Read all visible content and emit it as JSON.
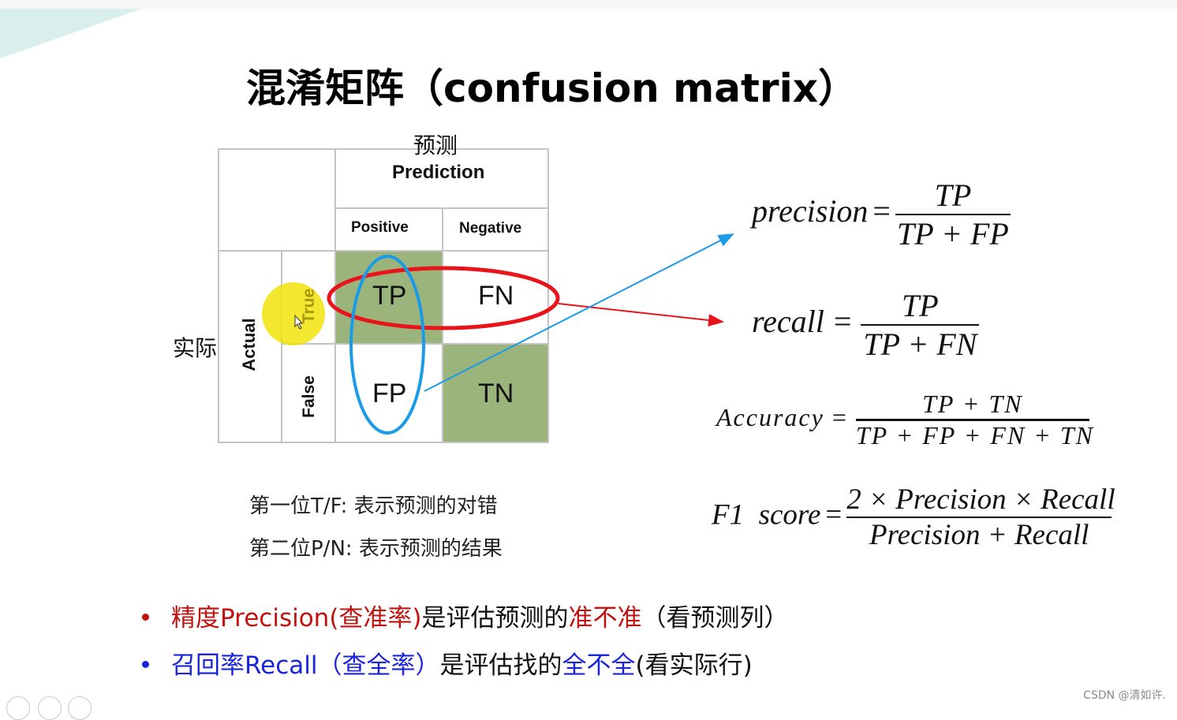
{
  "slide": {
    "title": "混淆矩阵（confusion matrix）",
    "colors": {
      "cell_green": "#9bb47c",
      "red_accent": "#c0120f",
      "blue_accent": "#1a24d8",
      "ellipse_red": "#e8141a",
      "ellipse_blue": "#1a9be8",
      "deco_teal": "#d9efec"
    }
  },
  "matrix": {
    "prediction_cn": "预测",
    "prediction_en": "Prediction",
    "actual_cn": "实际",
    "actual_en": "Actual",
    "col_headers": [
      "Positive",
      "Negative"
    ],
    "row_headers": [
      "True",
      "False"
    ],
    "cells": {
      "tp": "TP",
      "fn": "FN",
      "fp": "FP",
      "tn": "TN"
    }
  },
  "notes": [
    "第一位T/F: 表示预测的对错",
    "第二位P/N: 表示预测的结果"
  ],
  "formulas": {
    "precision": {
      "lhs": "precision",
      "num": "TP",
      "den": "TP + FP"
    },
    "recall": {
      "lhs": "recall",
      "num": "TP",
      "den": "TP + FN"
    },
    "accuracy": {
      "lhs": "Accuracy",
      "num": "TP + TN",
      "den": "TP + FP + FN + TN"
    },
    "f1": {
      "lhs": "F1  score",
      "num": "2 × Precision × Recall",
      "den": "Precision + Recall"
    }
  },
  "bullets": [
    {
      "parts": [
        {
          "text": "精度Precision(查准率)",
          "color": "red"
        },
        {
          "text": "是评估预测的",
          "color": "black"
        },
        {
          "text": "准不准",
          "color": "red"
        },
        {
          "text": "（看预测列）",
          "color": "black"
        }
      ]
    },
    {
      "parts": [
        {
          "text": "召回率Recall（查全率）",
          "color": "blue"
        },
        {
          "text": "是评估找的",
          "color": "black"
        },
        {
          "text": "全不全",
          "color": "blue"
        },
        {
          "text": "(看实际行)",
          "color": "black"
        }
      ]
    }
  ],
  "watermark": "CSDN @清如许."
}
